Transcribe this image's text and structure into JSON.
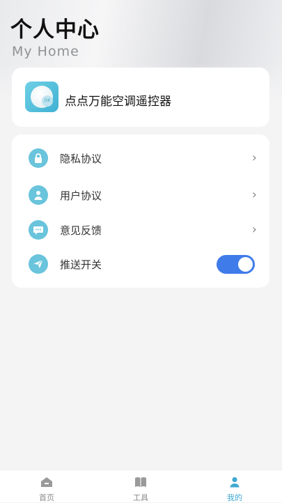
{
  "header": {
    "title": "个人中心",
    "subtitle": "My Home"
  },
  "app_card": {
    "icon": "remote-control-icon",
    "icon_text": "OK",
    "name": "点点万能空调遥控器"
  },
  "menu": {
    "items": [
      {
        "label": "隐私协议",
        "icon": "lock-icon"
      },
      {
        "label": "用户协议",
        "icon": "user-icon"
      },
      {
        "label": "意见反馈",
        "icon": "chat-icon"
      },
      {
        "label": "推送开关",
        "icon": "send-icon",
        "toggle_on": true
      }
    ],
    "chevron": "›"
  },
  "tabbar": {
    "tabs": [
      {
        "label": "首页",
        "icon": "home-icon",
        "active": false
      },
      {
        "label": "工具",
        "icon": "book-icon",
        "active": false
      },
      {
        "label": "我的",
        "icon": "person-icon",
        "active": true
      }
    ]
  },
  "colors": {
    "accent": "#3fa9d2",
    "icon_bg": "#69c4dc",
    "toggle_on": "#3f7be9"
  }
}
